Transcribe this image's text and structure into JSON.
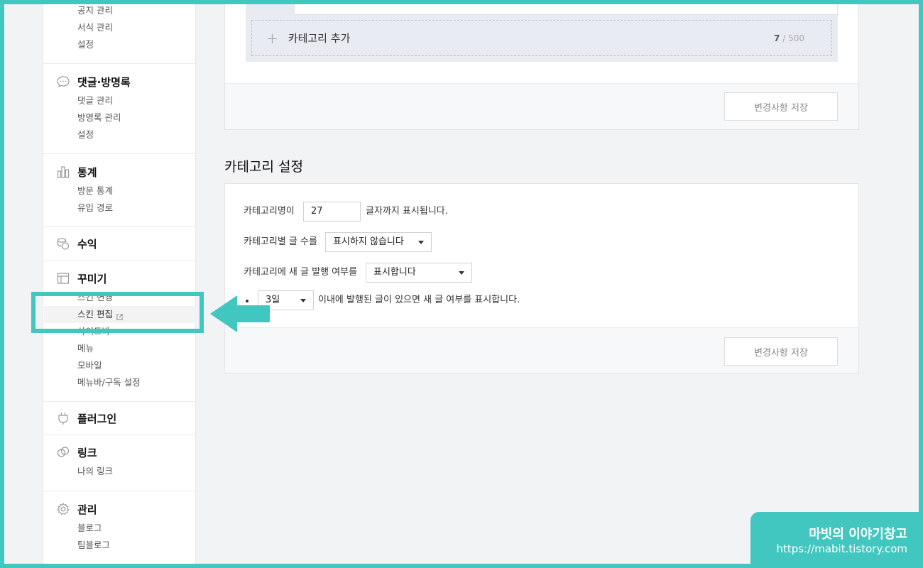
{
  "sidebar": {
    "top_items": [
      "공지 관리",
      "서식 관리",
      "설정"
    ],
    "comments": {
      "title": "댓글·방명록",
      "icon": "speech-bubble-icon",
      "items": [
        "댓글 관리",
        "방명록 관리",
        "설정"
      ]
    },
    "stats": {
      "title": "통계",
      "icon": "bar-chart-icon",
      "items": [
        "방문 통계",
        "유입 경로"
      ]
    },
    "revenue": {
      "title": "수익",
      "icon": "coins-icon"
    },
    "decorate": {
      "title": "꾸미기",
      "icon": "layout-icon",
      "items": [
        "스킨 변경",
        "스킨 편집",
        "사이드바",
        "메뉴",
        "모바일",
        "메뉴바/구독 설정"
      ]
    },
    "plugin": {
      "title": "플러그인",
      "icon": "plug-icon"
    },
    "link": {
      "title": "링크",
      "icon": "link-circles-icon",
      "items": [
        "나의 링크"
      ]
    },
    "manage": {
      "title": "관리",
      "icon": "gear-icon",
      "items": [
        "블로그",
        "팀블로그"
      ]
    }
  },
  "category_list": {
    "add_label": "카테고리 추가",
    "count": "7",
    "max": "/ 500",
    "save_label": "변경사항 저장"
  },
  "category_settings": {
    "heading": "카테고리 설정",
    "name_prefix": "카테고리명이",
    "name_value": "27",
    "name_suffix": "글자까지 표시됩니다.",
    "count_label": "카테고리별 글 수를",
    "count_select": "표시하지 않습니다",
    "new_label": "카테고리에 새 글 발행 여부를",
    "new_select": "표시합니다",
    "days_select": "3일",
    "days_suffix": "이내에 발행된 글이 있으면 새 글 여부를 표시합니다.",
    "save_label": "변경사항 저장"
  },
  "highlight": {
    "color": "#42c6c0"
  },
  "watermark": {
    "title": "마빗의 이야기창고",
    "url": "https://mabit.tistory.com"
  }
}
